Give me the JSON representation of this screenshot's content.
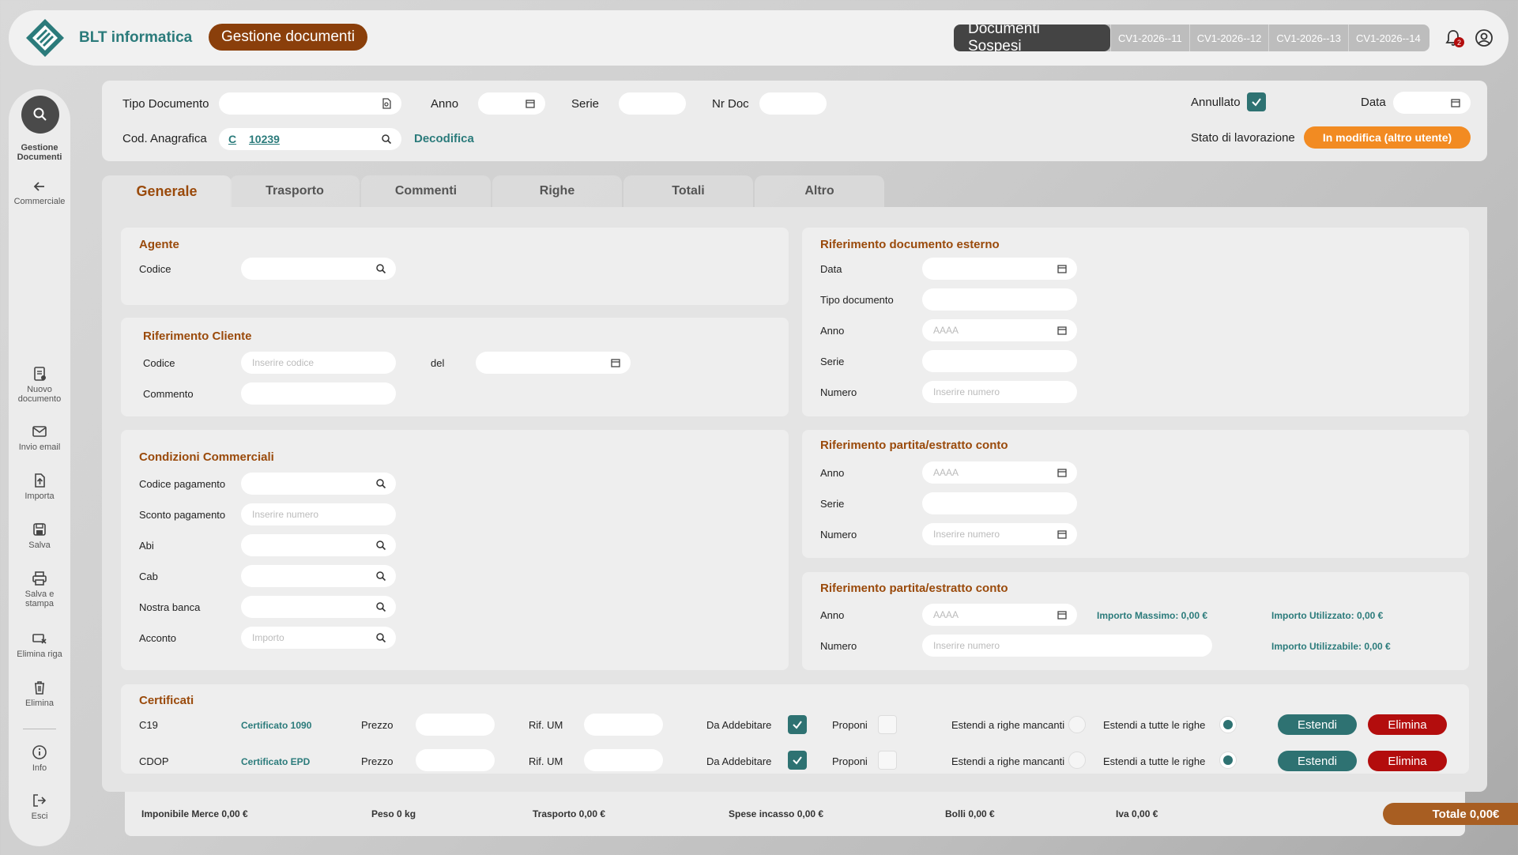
{
  "header": {
    "brand": "BLT informatica",
    "app_title": "Gestione documenti",
    "suspended_title": "Documenti Sospesi",
    "suspended_tabs": [
      "CV1-2026--11",
      "CV1-2026--12",
      "CV1-2026--13",
      "CV1-2026--14"
    ],
    "notifications_count": "2",
    "icons": [
      "bell-icon",
      "user-icon"
    ]
  },
  "sidebar": {
    "search_label": "Gestione Documenti",
    "back_label": "Commerciale",
    "items": [
      {
        "label": "Nuovo documento",
        "icon": "new-document-icon"
      },
      {
        "label": "Invio email",
        "icon": "email-icon"
      },
      {
        "label": "Importa",
        "icon": "import-icon"
      },
      {
        "label": "Salva",
        "icon": "save-icon"
      },
      {
        "label": "Salva e stampa",
        "icon": "print-icon"
      },
      {
        "label": "Elimina riga",
        "icon": "delete-row-icon"
      },
      {
        "label": "Elimina",
        "icon": "trash-icon"
      },
      {
        "label": "Info",
        "icon": "info-icon"
      },
      {
        "label": "Esci",
        "icon": "exit-icon"
      }
    ]
  },
  "filters": {
    "tipo_documento": "Tipo Documento",
    "anno": "Anno",
    "serie": "Serie",
    "nr_doc": "Nr Doc",
    "annullato": "Annullato",
    "data": "Data",
    "cod_anagrafica": "Cod. Anagrafica",
    "cod_prefix": "C",
    "cod_value": "10239",
    "decodifica": "Decodifica",
    "stato_label": "Stato di lavorazione",
    "stato_value": "In modifica (altro utente)"
  },
  "tabs": [
    "Generale",
    "Trasporto",
    "Commenti",
    "Righe",
    "Totali",
    "Altro"
  ],
  "agente": {
    "title": "Agente",
    "codice": "Codice"
  },
  "rif_cliente": {
    "title": "Riferimento Cliente",
    "codice": "Codice",
    "codice_placeholder": "Inserire codice",
    "del": "del",
    "commento": "Commento"
  },
  "condizioni": {
    "title": "Condizioni Commerciali",
    "codice_pagamento": "Codice pagamento",
    "sconto_pagamento": "Sconto pagamento",
    "sconto_placeholder": "Inserire numero",
    "abi": "Abi",
    "cab": "Cab",
    "nostra_banca": "Nostra banca",
    "acconto": "Acconto",
    "acconto_placeholder": "Importo"
  },
  "rif_esterno": {
    "title": "Riferimento documento esterno",
    "data": "Data",
    "tipo_documento": "Tipo documento",
    "anno": "Anno",
    "anno_placeholder": "AAAA",
    "serie": "Serie",
    "numero": "Numero",
    "numero_placeholder": "Inserire numero"
  },
  "rif_partita1": {
    "title": "Riferimento partita/estratto conto",
    "anno": "Anno",
    "anno_placeholder": "AAAA",
    "serie": "Serie",
    "numero": "Numero",
    "numero_placeholder": "Inserire numero"
  },
  "rif_partita2": {
    "title": "Riferimento partita/estratto conto",
    "anno": "Anno",
    "anno_placeholder": "AAAA",
    "numero": "Numero",
    "numero_placeholder": "Inserire numero",
    "importo_massimo": "Importo Massimo: 0,00 €",
    "importo_utilizzato": "Importo Utilizzato: 0,00 €",
    "importo_utilizzabile": "Importo Utilizzabile: 0,00 €"
  },
  "certificati": {
    "title": "Certificati",
    "rows": [
      {
        "code": "C19",
        "name": "Certificato 1090",
        "prezzo": "Prezzo",
        "rif_um": "Rif. UM",
        "da_addebitare": "Da Addebitare",
        "proponi": "Proponi",
        "estendi_mancanti": "Estendi a righe mancanti",
        "estendi_tutte": "Estendi a tutte le righe",
        "btn_estendi": "Estendi",
        "btn_elimina": "Elimina"
      },
      {
        "code": "CDOP",
        "name": "Certificato EPD",
        "prezzo": "Prezzo",
        "rif_um": "Rif. UM",
        "da_addebitare": "Da Addebitare",
        "proponi": "Proponi",
        "estendi_mancanti": "Estendi a righe mancanti",
        "estendi_tutte": "Estendi a tutte le righe",
        "btn_estendi": "Estendi",
        "btn_elimina": "Elimina"
      }
    ]
  },
  "footer": {
    "imponibile": "Imponibile Merce 0,00 €",
    "peso": "Peso 0 kg",
    "trasporto": "Trasporto 0,00 €",
    "spese_incasso": "Spese incasso 0,00 €",
    "bolli": "Bolli 0,00 €",
    "iva": "Iva 0,00 €",
    "totale": "Totale 0,00€"
  },
  "colors": {
    "brand_teal": "#2b7b7b",
    "title_brown": "#9a4a0b",
    "status_orange": "#f28b22",
    "danger_red": "#b30d0d"
  }
}
